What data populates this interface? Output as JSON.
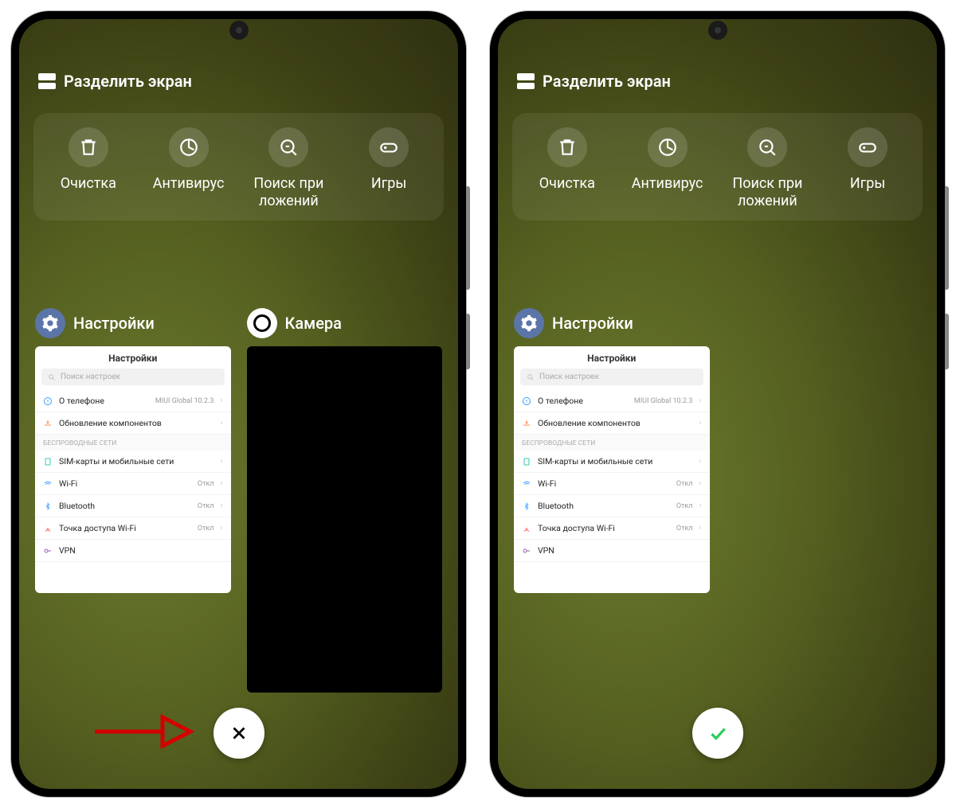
{
  "topbar": {
    "split_label": "Разделить экран"
  },
  "tools": [
    {
      "label": "Очистка"
    },
    {
      "label": "Антивирус"
    },
    {
      "label": "Поиск при\nложений"
    },
    {
      "label": "Игры"
    }
  ],
  "recents": {
    "settings": {
      "name": "Настройки"
    },
    "camera": {
      "name": "Камера"
    }
  },
  "settings_card": {
    "title": "Настройки",
    "search_placeholder": "Поиск настроек",
    "about_label": "О телефоне",
    "about_value": "MIUI Global 10.2.3",
    "update_label": "Обновление компонентов",
    "section_wireless": "Беспроводные сети",
    "sim_label": "SIM-карты и мобильные сети",
    "wifi_label": "Wi-Fi",
    "wifi_value": "Откл",
    "bt_label": "Bluetooth",
    "bt_value": "Откл",
    "hotspot_label": "Точка доступа Wi-Fi",
    "hotspot_value": "Откл",
    "vpn_label": "VPN"
  },
  "icon_colors": {
    "about": "#3aa0ff",
    "update": "#ff8a48",
    "sim": "#2eccb0",
    "wifi": "#3aa0ff",
    "bt": "#3aa0ff",
    "hotspot": "#ff6b6b",
    "vpn": "#9b59b6"
  }
}
